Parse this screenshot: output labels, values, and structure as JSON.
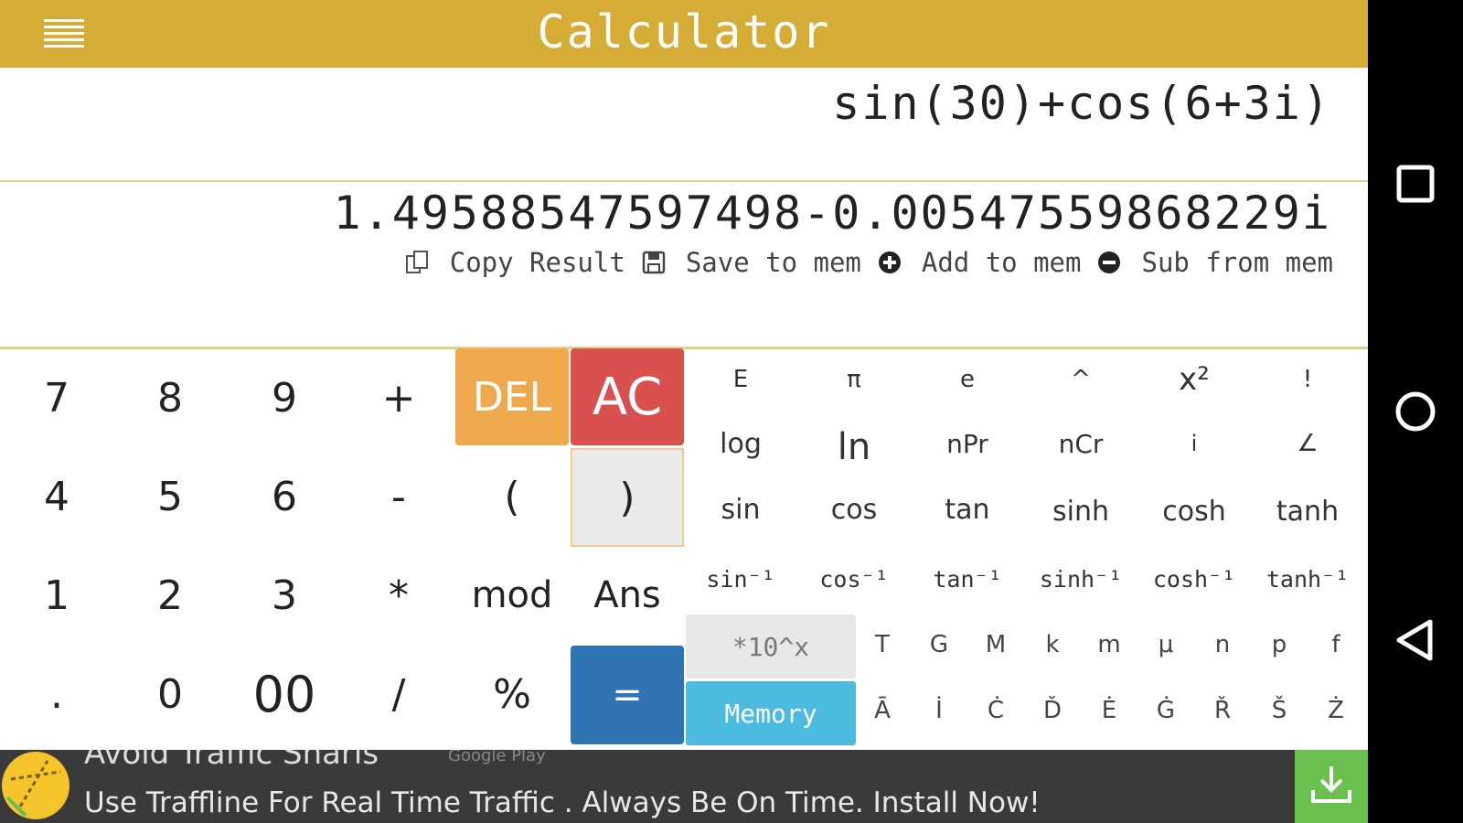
{
  "header": {
    "title": "Calculator",
    "menu_icon": "hamburger-menu-icon",
    "color": "#d4ac36"
  },
  "display": {
    "expression": "sin(30)+cos(6+3i)",
    "result": "1.49588547597498-0.00547559868229i"
  },
  "result_actions": [
    {
      "label": "Copy Result",
      "icon": "copy-icon"
    },
    {
      "label": "Save to mem",
      "icon": "save-icon"
    },
    {
      "label": "Add to mem",
      "icon": "plus-circle-icon"
    },
    {
      "label": "Sub from mem",
      "icon": "minus-circle-icon"
    }
  ],
  "keypad": {
    "digits": [
      [
        "7",
        "8",
        "9",
        "+"
      ],
      [
        "4",
        "5",
        "6",
        "-"
      ],
      [
        "1",
        "2",
        "3",
        "*"
      ],
      [
        ".",
        "0",
        "00",
        "/"
      ]
    ],
    "del": "DEL",
    "ac": "AC",
    "lparen": "(",
    "rparen": ")",
    "mod": "mod",
    "ans": "Ans",
    "percent": "%",
    "equals": "=",
    "exp": "*10^x",
    "memory": "Memory",
    "sci_rows": [
      [
        "E",
        "π",
        "e",
        "^",
        "x²",
        "!"
      ],
      [
        "log",
        "ln",
        "nPr",
        "nCr",
        "i",
        "∠"
      ],
      [
        "sin",
        "cos",
        "tan",
        "sinh",
        "cosh",
        "tanh"
      ],
      [
        "sin⁻¹",
        "cos⁻¹",
        "tan⁻¹",
        "sinh⁻¹",
        "cosh⁻¹",
        "tanh⁻¹"
      ]
    ],
    "prefixes": [
      "T",
      "G",
      "M",
      "k",
      "m",
      "μ",
      "n",
      "p",
      "f"
    ],
    "memory_vars": [
      "Ā",
      "İ",
      "Ċ",
      "Ď",
      "Ė",
      "Ġ",
      "Ř",
      "Š",
      "Ż"
    ]
  },
  "ad": {
    "title": "Avoid Traffic Snarls",
    "sponsor": "Google Play",
    "text": "Use Traffline For Real Time Traffic . Always Be On Time. Install Now!"
  },
  "nav": [
    "recents-square-icon",
    "home-circle-icon",
    "back-triangle-icon"
  ]
}
